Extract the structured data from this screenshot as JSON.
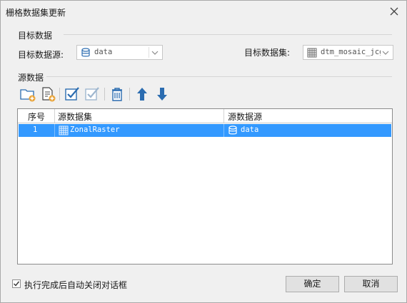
{
  "window": {
    "title": "栅格数据集更新",
    "close_symbol": "✕"
  },
  "target": {
    "group_label": "目标数据",
    "datasource_label": "目标数据源:",
    "datasource_value": "data",
    "dataset_label": "目标数据集:",
    "dataset_value": "dtm_mosaic_jcg"
  },
  "source": {
    "group_label": "源数据",
    "toolbar_icons": [
      "add-folder-icon",
      "add-file-icon",
      "select-all-icon",
      "select-none-icon",
      "delete-icon",
      "move-up-icon",
      "move-down-icon"
    ],
    "columns": [
      "序号",
      "源数据集",
      "源数据源"
    ],
    "rows": [
      {
        "index": "1",
        "dataset": "ZonalRaster",
        "datasource": "data",
        "selected": true
      }
    ]
  },
  "footer": {
    "checkbox_label": "执行完成后自动关闭对话框",
    "checkbox_checked": true,
    "ok_label": "确定",
    "cancel_label": "取消"
  },
  "colors": {
    "selection": "#3399ff",
    "icon_blue": "#2b6cb0",
    "folder_orange": "#e9a43a"
  }
}
